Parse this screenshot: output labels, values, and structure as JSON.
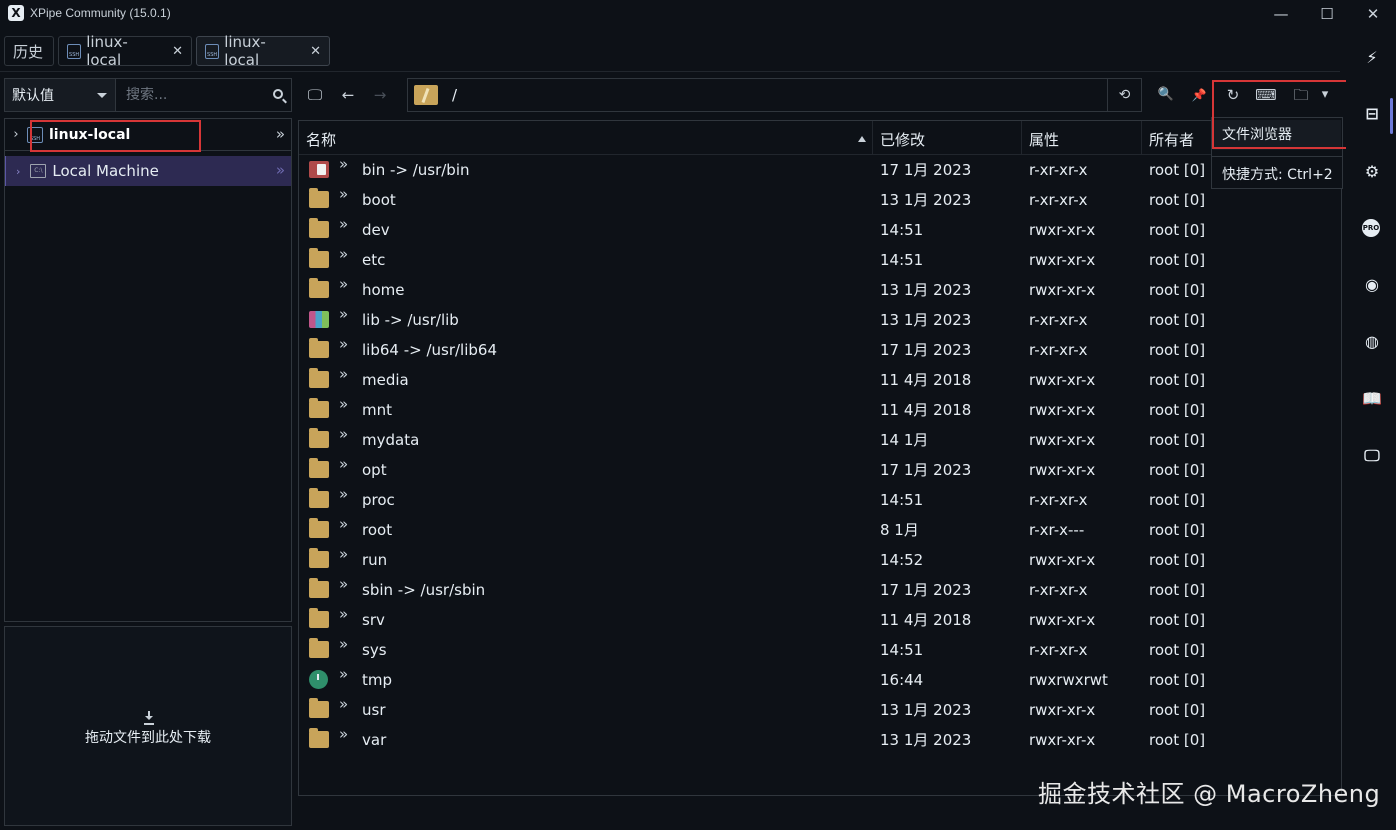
{
  "window": {
    "title": "XPipe Community (15.0.1)",
    "logo_glyph": "X"
  },
  "window_controls": {
    "minimize": "—",
    "maximize": "☐",
    "close": "✕"
  },
  "tabs": [
    {
      "label": "历史"
    },
    {
      "label": "linux-local",
      "icon": "ssh-icon",
      "close": "✕"
    },
    {
      "label": "linux-local",
      "icon": "ssh-icon",
      "close": "✕",
      "active": true
    }
  ],
  "left_panel": {
    "category_select": "默认值",
    "search_placeholder": "搜索...",
    "tree": {
      "root_label": "linux-local",
      "root_chevron": "›",
      "child_label": "Local Machine",
      "child_chevron": "›",
      "expand": "»"
    },
    "dropzone_text": "拖动文件到此处下载"
  },
  "toolbar": {
    "path": "/",
    "icons": [
      "monitor-icon",
      "back-arrow-icon",
      "forward-arrow-icon",
      "history-icon",
      "search-icon",
      "pin-icon",
      "refresh-icon",
      "terminal-icon",
      "folder-menu-icon"
    ],
    "glyphs": {
      "monitor": "🖵",
      "back": "←",
      "forward": "→",
      "history": "⟲",
      "search": "🔍",
      "pin": "📌",
      "refresh": "↻",
      "terminal": "⌨",
      "folder": "🗀",
      "folder_caret": "▾"
    }
  },
  "popup": {
    "item_label": "文件浏览器",
    "shortcut_label": "快捷方式: Ctrl+2"
  },
  "table": {
    "headers": {
      "name": "名称",
      "modified": "已修改",
      "attributes": "属性",
      "owner": "所有者"
    },
    "row_chevron": "»",
    "rows": [
      {
        "icon": "bin",
        "name": "bin -> /usr/bin",
        "modified": "17 1月 2023",
        "attributes": "r-xr-xr-x",
        "owner": "root [0]"
      },
      {
        "icon": "folder",
        "name": "boot",
        "modified": "13 1月 2023",
        "attributes": "r-xr-xr-x",
        "owner": "root [0]"
      },
      {
        "icon": "folder",
        "name": "dev",
        "modified": "14:51",
        "attributes": "rwxr-xr-x",
        "owner": "root [0]"
      },
      {
        "icon": "folder",
        "name": "etc",
        "modified": "14:51",
        "attributes": "rwxr-xr-x",
        "owner": "root [0]"
      },
      {
        "icon": "folder",
        "name": "home",
        "modified": "13 1月 2023",
        "attributes": "rwxr-xr-x",
        "owner": "root [0]"
      },
      {
        "icon": "lib",
        "name": "lib -> /usr/lib",
        "modified": "13 1月 2023",
        "attributes": "r-xr-xr-x",
        "owner": "root [0]"
      },
      {
        "icon": "folder",
        "name": "lib64 -> /usr/lib64",
        "modified": "17 1月 2023",
        "attributes": "r-xr-xr-x",
        "owner": "root [0]"
      },
      {
        "icon": "folder",
        "name": "media",
        "modified": "11 4月 2018",
        "attributes": "rwxr-xr-x",
        "owner": "root [0]"
      },
      {
        "icon": "folder",
        "name": "mnt",
        "modified": "11 4月 2018",
        "attributes": "rwxr-xr-x",
        "owner": "root [0]"
      },
      {
        "icon": "folder",
        "name": "mydata",
        "modified": "14 1月",
        "attributes": "rwxr-xr-x",
        "owner": "root [0]"
      },
      {
        "icon": "folder",
        "name": "opt",
        "modified": "17 1月 2023",
        "attributes": "rwxr-xr-x",
        "owner": "root [0]"
      },
      {
        "icon": "folder",
        "name": "proc",
        "modified": "14:51",
        "attributes": "r-xr-xr-x",
        "owner": "root [0]"
      },
      {
        "icon": "folder",
        "name": "root",
        "modified": "8 1月",
        "attributes": "r-xr-x---",
        "owner": "root [0]"
      },
      {
        "icon": "folder",
        "name": "run",
        "modified": "14:52",
        "attributes": "rwxr-xr-x",
        "owner": "root [0]"
      },
      {
        "icon": "folder",
        "name": "sbin -> /usr/sbin",
        "modified": "17 1月 2023",
        "attributes": "r-xr-xr-x",
        "owner": "root [0]"
      },
      {
        "icon": "folder",
        "name": "srv",
        "modified": "11 4月 2018",
        "attributes": "rwxr-xr-x",
        "owner": "root [0]"
      },
      {
        "icon": "folder",
        "name": "sys",
        "modified": "14:51",
        "attributes": "r-xr-xr-x",
        "owner": "root [0]"
      },
      {
        "icon": "tmp",
        "name": "tmp",
        "modified": "16:44",
        "attributes": "rwxrwxrwt",
        "owner": "root [0]"
      },
      {
        "icon": "folder",
        "name": "usr",
        "modified": "13 1月 2023",
        "attributes": "rwxr-xr-x",
        "owner": "root [0]"
      },
      {
        "icon": "folder",
        "name": "var",
        "modified": "13 1月 2023",
        "attributes": "rwxr-xr-x",
        "owner": "root [0]"
      }
    ]
  },
  "right_rail": [
    {
      "icon": "plug-icon",
      "glyph": "⚡"
    },
    {
      "icon": "file-browser-icon",
      "glyph": "⊟",
      "active": true
    },
    {
      "icon": "settings-icon",
      "glyph": "⚙"
    },
    {
      "icon": "pro-icon",
      "glyph": "PRO"
    },
    {
      "icon": "github-icon",
      "glyph": "◉"
    },
    {
      "icon": "discord-icon",
      "glyph": "◍"
    },
    {
      "icon": "docs-book-icon",
      "glyph": "📖"
    },
    {
      "icon": "desktop-icon",
      "glyph": "🖵"
    }
  ],
  "watermark": "掘金技术社区 @ MacroZheng",
  "colors": {
    "background": "#0d1117",
    "border": "#30363d",
    "highlight_red": "#d63637",
    "selected_row": "#2d2a52",
    "folder": "#c8a45a"
  }
}
